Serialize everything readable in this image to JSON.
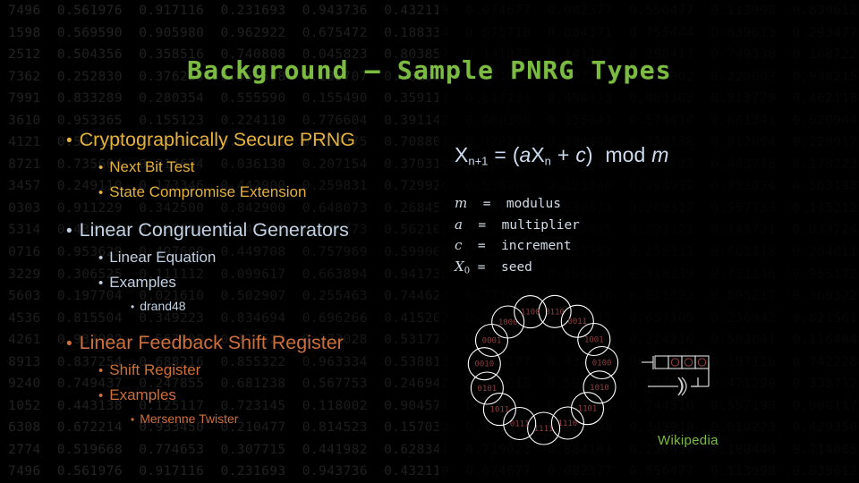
{
  "slide": {
    "title": "Background – Sample PNRG Types",
    "title_color": "#7cbb42",
    "background_color": "#000000"
  },
  "outline": {
    "groups": [
      {
        "color": "#e4b13b",
        "items": [
          {
            "level": 1,
            "bullet": "•",
            "label": "Cryptographically Secure PRNG"
          },
          {
            "level": 2,
            "bullet": "•",
            "label": "Next Bit Test"
          },
          {
            "level": 2,
            "bullet": "•",
            "label": "State Compromise Extension"
          }
        ]
      },
      {
        "color": "#c2d2e4",
        "items": [
          {
            "level": 1,
            "bullet": "•",
            "label": "Linear Congruential Generators"
          },
          {
            "level": 2,
            "bullet": "•",
            "label": "Linear Equation"
          },
          {
            "level": 2,
            "bullet": "•",
            "label": "Examples"
          },
          {
            "level": 3,
            "bullet": "•",
            "label": "drand48"
          }
        ]
      },
      {
        "color": "#cf6f39",
        "items": [
          {
            "level": 1,
            "bullet": "•",
            "label": "Linear Feedback Shift Register"
          },
          {
            "level": 2,
            "bullet": "•",
            "label": "Shift Register"
          },
          {
            "level": 2,
            "bullet": "•",
            "label": "Examples"
          },
          {
            "level": 3,
            "bullet": "•",
            "label": "Mersenne Twister"
          }
        ]
      }
    ]
  },
  "formula": {
    "color": "#ccdcf0",
    "lhs_var": "X",
    "lhs_sub": "n+1",
    "equals": "=",
    "open_paren": "(",
    "a": "a",
    "x": "X",
    "x_sub": "n",
    "plus": "+",
    "c": "c",
    "close_paren": ")",
    "mod": "mod",
    "m": "m",
    "plain_text": "Xn+1 = (aXn + c) mod m"
  },
  "legend": {
    "rows": [
      {
        "symbol": "m",
        "sub": "",
        "eq": "=",
        "meaning": "modulus"
      },
      {
        "symbol": "a",
        "sub": "",
        "eq": "=",
        "meaning": "multiplier"
      },
      {
        "symbol": "c",
        "sub": "",
        "eq": "=",
        "meaning": "increment"
      },
      {
        "symbol": "X",
        "sub": "0",
        "eq": "=",
        "meaning": "seed"
      }
    ]
  },
  "lfsr_diagram": {
    "caption": "Wikipedia",
    "caption_color": "#7cbb42",
    "node_color": "#8c3f3f",
    "edge_color": "#ffffff",
    "states": [
      "0110",
      "0011",
      "1001",
      "0100",
      "1010",
      "1101",
      "1110",
      "1111",
      "0111",
      "1011",
      "0101",
      "0010",
      "0001",
      "1000",
      "1100"
    ]
  },
  "circuit_diagram": {
    "bit_cells": 4,
    "gate": "XOR",
    "color": "#8c3f3f",
    "wire_color": "#dcdcdc"
  },
  "background_texture": {
    "description": "faint grey columns of random decimal numbers",
    "color": "#242424",
    "rows": [
      " 7496  0.561976  0.917116  0.231693  0.943736  0.432119  0.674677  0.082377  0.556477  0.113998  0.839612",
      " 1598  0.569590  0.905980  0.962922  0.675472  0.188334  0.675718  0.884371  0.755444  0.639613  0.293477",
      " 2512  0.504356  0.358516  0.740808  0.045823  0.803857  0.141073  0.141142  0.298417  0.749338  0.108722",
      " 7362  0.252830  0.376253  0.557508  0.133707  0.761608  0.141073  0.577726  0.277902  0.228607  0.930215",
      " 7991  0.833289  0.280354  0.555590  0.155490  0.359117  0.617734  0.498373  0.083363  0.913779  0.462118",
      " 3610  0.953365  0.155123  0.224110  0.776604  0.391142  0.660308  0.135041  0.574414  0.601341  0.620944",
      " 4121  0.544155  0.104963  0.098111  0.065875  0.708801  0.478235  0.394449  0.350138  0.812094  0.229917",
      " 8721  0.735604  0.314634  0.036130  0.207154  0.370314  0.595447  0.600381  0.158723  0.463718  0.178223",
      " 3457  0.249110  0.173346  0.442900  0.259831  0.729920  0.538765  0.123340  0.208917  0.991034  0.563198",
      " 0303  0.911229  0.342500  0.842900  0.648073  0.268453  0.645163  0.630633  0.209317  0.557733  0.145212",
      " 5314  0.433614  0.587508  0.247418  0.348773  0.562101  0.230688  0.712035  0.393121  0.141721  0.833724",
      " 0716  0.953629  0.497608  0.449708  0.757969  0.599005  0.125173  0.411757  0.259311  0.661318  0.204811",
      " 3229  0.306525  0.111112  0.099617  0.663894  0.941736  0.236113  0.155886  0.318239  0.731146  0.955172",
      " 5603  0.197704  0.021610  0.502907  0.255463  0.744621  0.271459  0.113318  0.811323  0.605217  0.360322",
      " 4536  0.815504  0.349223  0.834694  0.696266  0.415207  0.927137  0.341211  0.657109  0.236942  0.821561",
      " 4261  0.937982  0.567008  0.114523  0.372028  0.531772  0.538115  0.713418  0.224216  0.503841  0.116404",
      " 8913  0.837254  0.688216  0.855322  0.963334  0.538813  0.265177  0.437413  0.350089  0.197116  0.742228",
      " 9240  0.749437  0.247855  0.681238  0.567753  0.246942  0.851618  0.590509  0.127604  0.471290  0.338712",
      " 1052  0.443138  0.125117  0.723145  0.118002  0.904571  0.330815  0.262003  0.744510  0.557190  0.908117",
      " 6308  0.672214  0.933450  0.210477  0.814523  0.157033  0.482610  0.137008  0.349918  0.610223  0.429356",
      " 2774  0.519668  0.774653  0.307715  0.441982  0.628341  0.719023  0.884101  0.230517  0.188440  0.714085"
    ]
  }
}
